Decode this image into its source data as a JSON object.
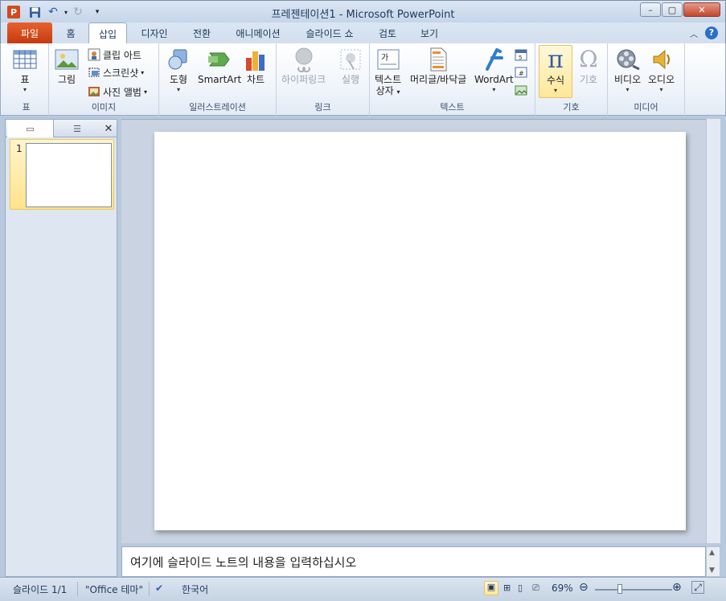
{
  "window": {
    "title": "프레젠테이션1  -  Microsoft PowerPoint",
    "minimize": "–",
    "maximize": "▢",
    "close": "✕"
  },
  "tabs": [
    {
      "label": "파일",
      "type": "file"
    },
    {
      "label": "홈"
    },
    {
      "label": "삽입",
      "active": true
    },
    {
      "label": "디자인"
    },
    {
      "label": "전환"
    },
    {
      "label": "애니메이션"
    },
    {
      "label": "슬라이드 쇼"
    },
    {
      "label": "검토"
    },
    {
      "label": "보기"
    }
  ],
  "ribbon": {
    "groups": {
      "table": "표",
      "images": "이미지",
      "illustrations": "일러스트레이션",
      "links": "링크",
      "text": "텍스트",
      "symbols": "기호",
      "media": "미디어"
    },
    "buttons": {
      "table": "표",
      "picture": "그림",
      "clipart": "클립 아트",
      "screenshot": "스크린샷",
      "photo_album": "사진 앨범",
      "shapes": "도형",
      "smartart": "SmartArt",
      "chart": "차트",
      "hyperlink": "하이퍼링크",
      "action": "실행",
      "textbox_line1": "텍스트",
      "textbox_line2": "상자",
      "header_footer": "머리글/바닥글",
      "wordart": "WordArt",
      "equation": "수식",
      "symbol": "기호",
      "video": "비디오",
      "audio": "오디오"
    }
  },
  "slides_panel": {
    "slide_number": "1"
  },
  "notes": {
    "placeholder": "여기에 슬라이드 노트의 내용을 입력하십시오"
  },
  "statusbar": {
    "slide_info": "슬라이드 1/1",
    "theme": "\"Office 테마\"",
    "language": "한국어",
    "zoom": "69%",
    "zoom_value": 0.69
  },
  "colors": {
    "file_tab": "#d24a1d",
    "accent": "#1e395b",
    "selection": "#ffe38c"
  }
}
